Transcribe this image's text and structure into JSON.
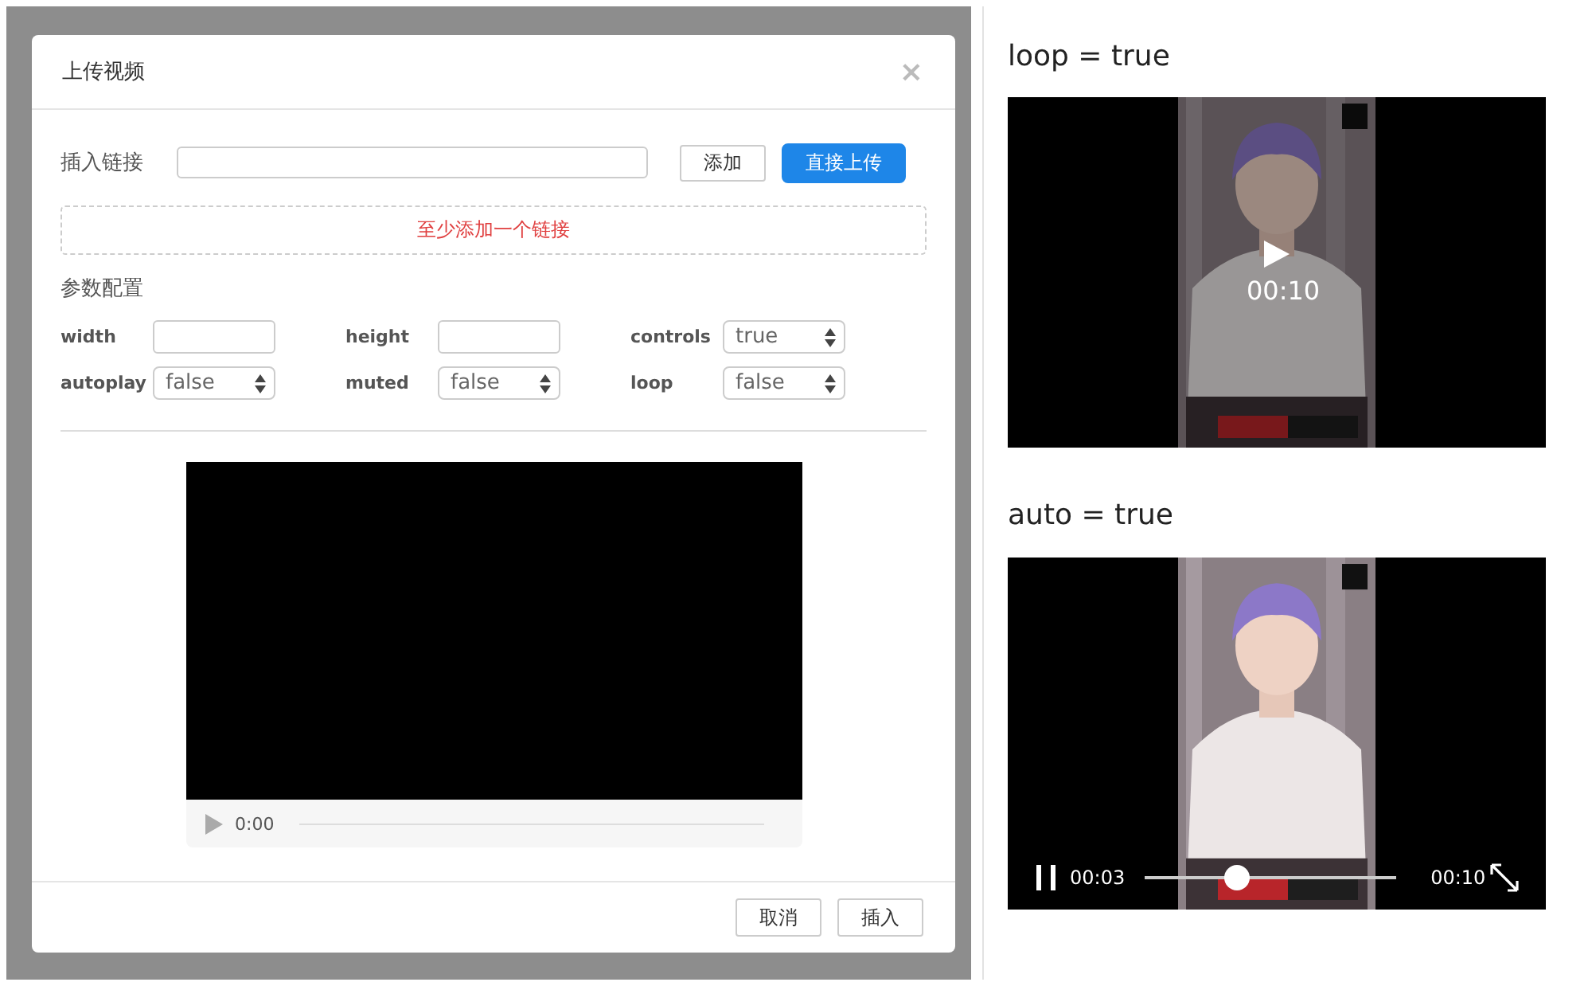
{
  "dialog": {
    "title": "上传视频",
    "close": "×",
    "link": {
      "label": "插入链接",
      "add_button": "添加",
      "upload_button": "直接上传"
    },
    "link_hint": "至少添加一个链接",
    "params_title": "参数配置",
    "params": [
      {
        "label": "width",
        "kind": "input"
      },
      {
        "label": "height",
        "kind": "input"
      },
      {
        "label": "controls",
        "kind": "select",
        "value": "true"
      },
      {
        "label": "autoplay",
        "kind": "select",
        "value": "false"
      },
      {
        "label": "muted",
        "kind": "select",
        "value": "false"
      },
      {
        "label": "loop",
        "kind": "select",
        "value": "false"
      }
    ],
    "preview": {
      "time": "0:00"
    },
    "buttons": [
      "取消",
      "插入"
    ]
  },
  "demos": [
    {
      "caption": "loop = true",
      "kind": "paused",
      "time": "00:10"
    },
    {
      "caption": "auto = true",
      "kind": "playing",
      "current": "00:03",
      "duration": "00:10",
      "level": 0.37
    }
  ]
}
